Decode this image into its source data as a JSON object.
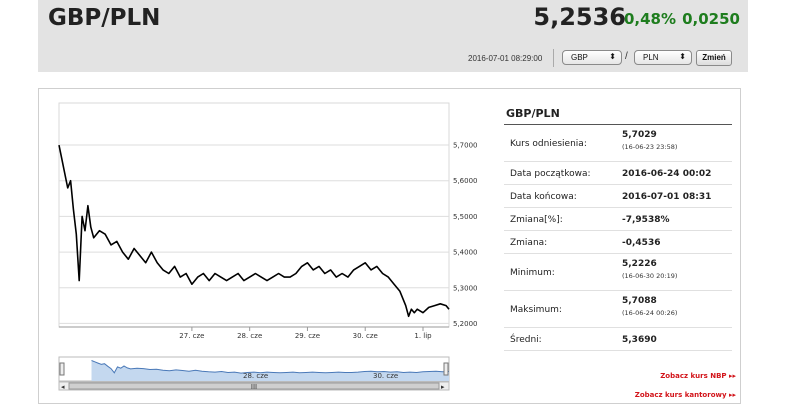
{
  "header": {
    "pair": "GBP/PLN",
    "rate": "5,2536",
    "change_pct": "0,48%",
    "change_abs": "0,0250"
  },
  "controls": {
    "timestamp": "2016-07-01 08:29:00",
    "from_currency": "GBP",
    "slash": "/",
    "to_currency": "PLN",
    "change_button": "Zmień"
  },
  "colors": {
    "positive": "#1e7d1e",
    "link": "#d2141a",
    "navigator_fill": "#c4d8ef",
    "navigator_line": "#4a79b8"
  },
  "info": {
    "title": "GBP/PLN",
    "rows": [
      {
        "label": "Kurs odniesienia:",
        "value": "5,7029",
        "sub": "(16-06-23 23:58)"
      },
      {
        "label": "Data początkowa:",
        "value": "2016-06-24 00:02"
      },
      {
        "label": "Data końcowa:",
        "value": "2016-07-01 08:31"
      },
      {
        "label": "Zmiana[%]:",
        "value": "-7,9538%"
      },
      {
        "label": "Zmiana:",
        "value": "-0,4536"
      },
      {
        "label": "Minimum:",
        "value": "5,2226",
        "sub": "(16-06-30 20:19)"
      },
      {
        "label": "Maksimum:",
        "value": "5,7088",
        "sub": "(16-06-24 00:26)"
      },
      {
        "label": "Średni:",
        "value": "5,3690"
      }
    ],
    "links": {
      "nbp": "Zobacz kurs NBP ▸▸",
      "kantor": "Zobacz kurs kantorowy ▸▸"
    }
  },
  "chart_data": {
    "type": "line",
    "ylim": [
      5.19,
      5.745
    ],
    "y_ticks": [
      "5,7000",
      "5,6000",
      "5,5000",
      "5,4000",
      "5,3000",
      "5,2000"
    ],
    "y_tick_values": [
      5.7,
      5.6,
      5.5,
      5.4,
      5.3,
      5.2
    ],
    "x_ticks": [
      "27. cze",
      "28. cze",
      "29. cze",
      "30. cze",
      "1. lip"
    ],
    "x_tick_values": [
      2.3,
      3.3,
      4.3,
      5.3,
      6.3
    ],
    "xlim": [
      0,
      6.75
    ],
    "navigator_labels": [
      "28. cze",
      "30. cze"
    ],
    "navigator_label_values": [
      2.3,
      4.3
    ],
    "navigator_xlim": [
      -0.5,
      5.5
    ],
    "navigator_scroll_label": "III",
    "series": [
      {
        "x": [
          0,
          0.05,
          0.1,
          0.15,
          0.2,
          0.25,
          0.3,
          0.35,
          0.4,
          0.45,
          0.5,
          0.55,
          0.6,
          0.7,
          0.8,
          0.9,
          1.0,
          1.1,
          1.2,
          1.3,
          1.4,
          1.5,
          1.6,
          1.7,
          1.8,
          1.9,
          2.0,
          2.1,
          2.2,
          2.3,
          2.4,
          2.5,
          2.6,
          2.7,
          2.8,
          2.9,
          3.0,
          3.1,
          3.2,
          3.3,
          3.4,
          3.5,
          3.6,
          3.7,
          3.8,
          3.9,
          4.0,
          4.1,
          4.2,
          4.3,
          4.4,
          4.5,
          4.6,
          4.7,
          4.8,
          4.9,
          5.0,
          5.1,
          5.2,
          5.3,
          5.4,
          5.5,
          5.6,
          5.7,
          5.8,
          5.9,
          6.0,
          6.05,
          6.1,
          6.15,
          6.2,
          6.3,
          6.4,
          6.5,
          6.6,
          6.7,
          6.75
        ],
        "y": [
          5.7,
          5.66,
          5.62,
          5.58,
          5.6,
          5.52,
          5.45,
          5.32,
          5.5,
          5.46,
          5.53,
          5.47,
          5.44,
          5.46,
          5.45,
          5.42,
          5.43,
          5.4,
          5.38,
          5.41,
          5.39,
          5.37,
          5.4,
          5.37,
          5.35,
          5.34,
          5.36,
          5.33,
          5.34,
          5.31,
          5.33,
          5.34,
          5.32,
          5.34,
          5.33,
          5.32,
          5.33,
          5.34,
          5.32,
          5.33,
          5.34,
          5.33,
          5.32,
          5.33,
          5.34,
          5.33,
          5.33,
          5.34,
          5.36,
          5.37,
          5.35,
          5.36,
          5.34,
          5.35,
          5.33,
          5.34,
          5.33,
          5.35,
          5.36,
          5.37,
          5.35,
          5.36,
          5.34,
          5.33,
          5.31,
          5.29,
          5.25,
          5.22,
          5.24,
          5.23,
          5.24,
          5.23,
          5.245,
          5.25,
          5.255,
          5.25,
          5.24
        ]
      }
    ]
  }
}
